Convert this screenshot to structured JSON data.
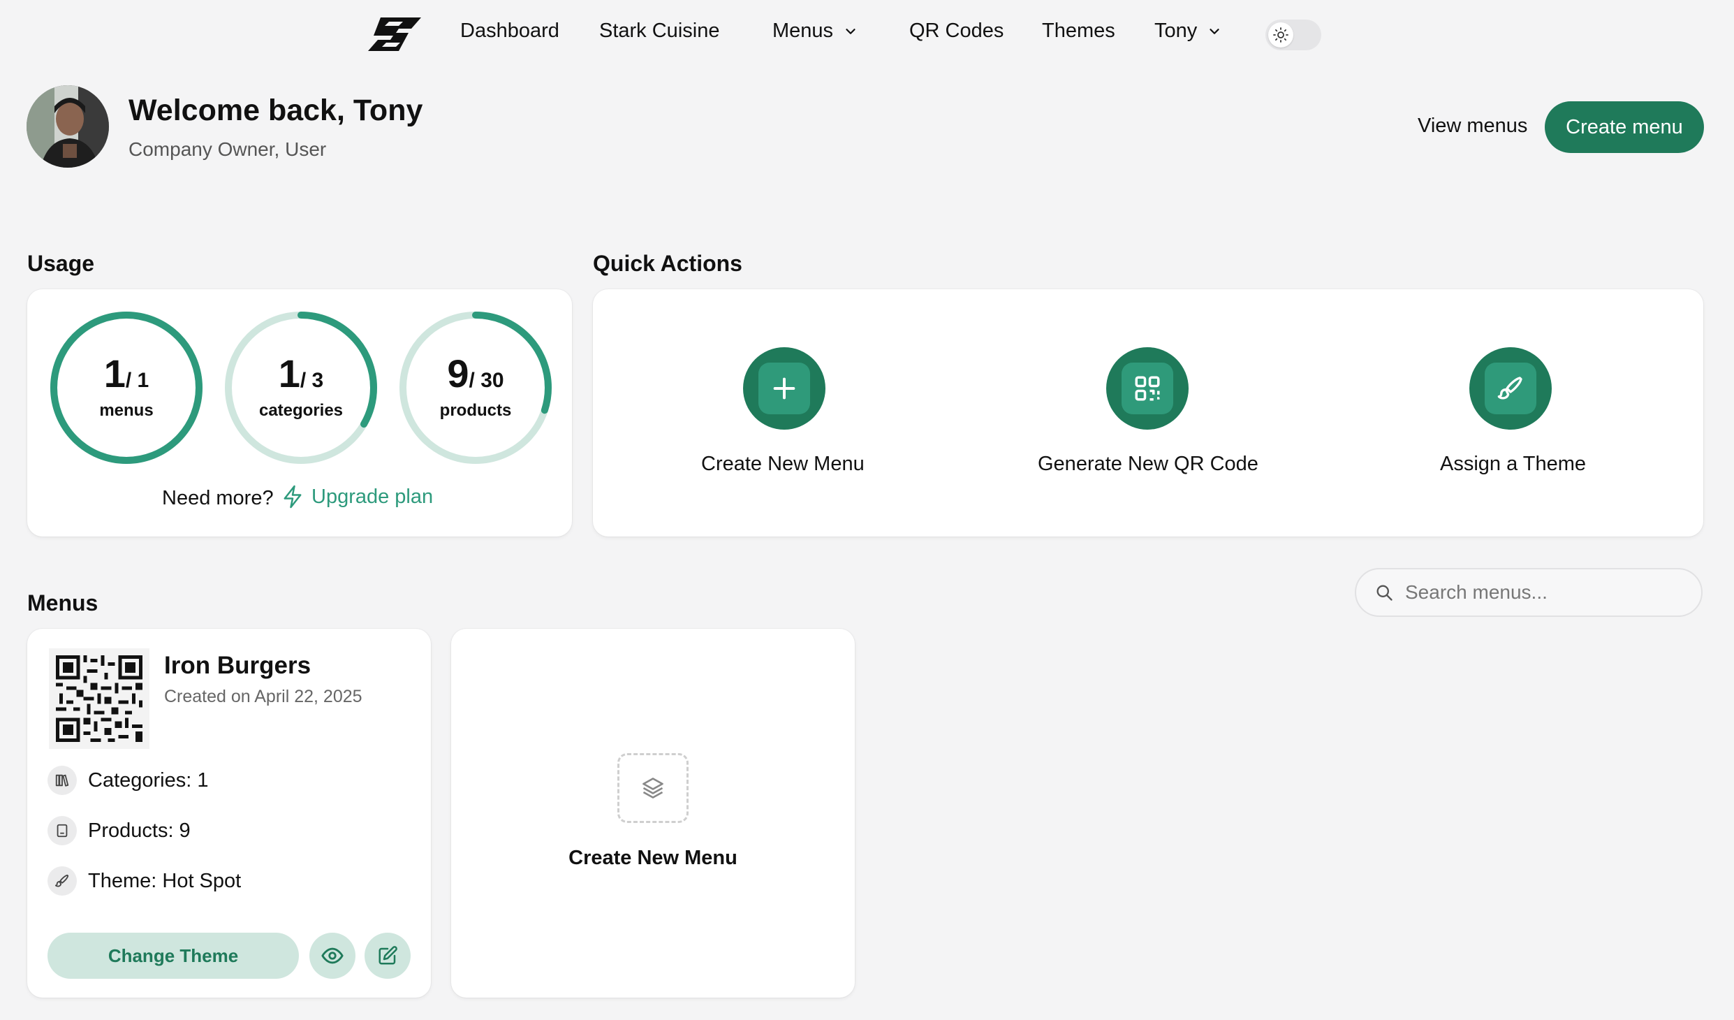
{
  "nav": {
    "items": [
      "Dashboard",
      "Stark Cuisine",
      "Menus",
      "QR Codes",
      "Themes",
      "Tony"
    ]
  },
  "welcome": {
    "title": "Welcome back, Tony",
    "subtitle": "Company Owner, User",
    "view_menus": "View menus",
    "create_menu": "Create menu"
  },
  "usage": {
    "heading": "Usage",
    "rings": [
      {
        "used": "1",
        "limit": "/ 1",
        "label": "menus",
        "used_value": 1,
        "limit_value": 1
      },
      {
        "used": "1",
        "limit": "/ 3",
        "label": "categories",
        "used_value": 1,
        "limit_value": 3
      },
      {
        "used": "9",
        "limit": "/ 30",
        "label": "products",
        "used_value": 9,
        "limit_value": 30
      }
    ],
    "need_more": "Need more?",
    "upgrade": "Upgrade plan"
  },
  "quick_actions": {
    "heading": "Quick Actions",
    "items": [
      "Create New Menu",
      "Generate New QR Code",
      "Assign a Theme"
    ]
  },
  "menus": {
    "heading": "Menus",
    "search_placeholder": "Search menus...",
    "cards": [
      {
        "name": "Iron Burgers",
        "created": "Created on April 22, 2025",
        "categories": "Categories: 1",
        "products": "Products: 9",
        "theme": "Theme: Hot Spot",
        "change_theme": "Change Theme"
      }
    ],
    "new_menu_label": "Create New Menu"
  },
  "colors": {
    "accent": "#1f7a5a",
    "accent_light": "#2f9a7a",
    "ring_track": "#cfe6de",
    "ring_fill": "#2d9a7c",
    "button_soft": "#cfe6de"
  }
}
